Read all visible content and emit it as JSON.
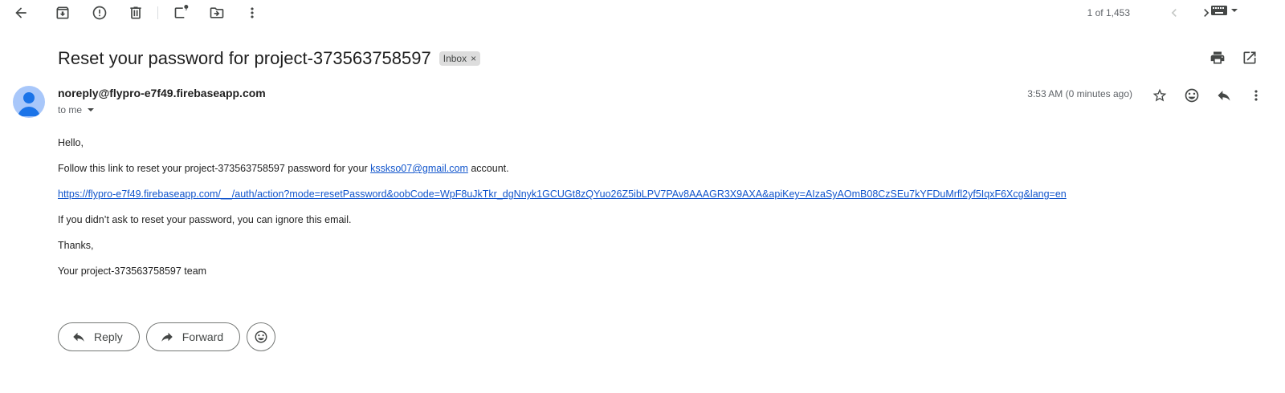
{
  "toolbar": {
    "icons": [
      "back-arrow-icon",
      "archive-icon",
      "report-spam-icon",
      "delete-icon",
      "mark-unread-icon",
      "move-to-icon",
      "more-vert-icon"
    ],
    "pager_text": "1 of 1,453"
  },
  "email": {
    "subject": "Reset your password for project-373563758597",
    "label": "Inbox",
    "label_remove": "×",
    "sender": "noreply@flypro-e7f49.firebaseapp.com",
    "to": "to me",
    "time": "3:53 AM (0 minutes ago)",
    "body": {
      "greeting": "Hello,",
      "line1_prefix": "Follow this link to reset your project-373563758597 password for your",
      "email_link": "kssksо07@gmail.com",
      "line1_suffix": "account.",
      "reset_link": "https://flypro-e7f49.firebaseapp.com/__/auth/action?mode=resetPassword&oobCode=WpF8uJkTkr_dgNnyk1GCUGt8zQYuo26Z5ibLPV7PAv8AAAGR3X9AXA&apiKey=AIzaSyAOmB08CzSEu7kYFDuMrfl2yf5IqxF6Xcg&lang=en",
      "line3": "If you didn’t ask to reset your password, you can ignore this email.",
      "thanks": "Thanks,",
      "signature": "Your project-373563758597 team"
    }
  },
  "actions": {
    "reply_label": "Reply",
    "forward_label": "Forward"
  },
  "colors": {
    "link": "#1155cc",
    "avatar_bg": "#a8c7fa",
    "avatar_fg": "#1a73e8",
    "chip_bg": "#dddddd"
  }
}
